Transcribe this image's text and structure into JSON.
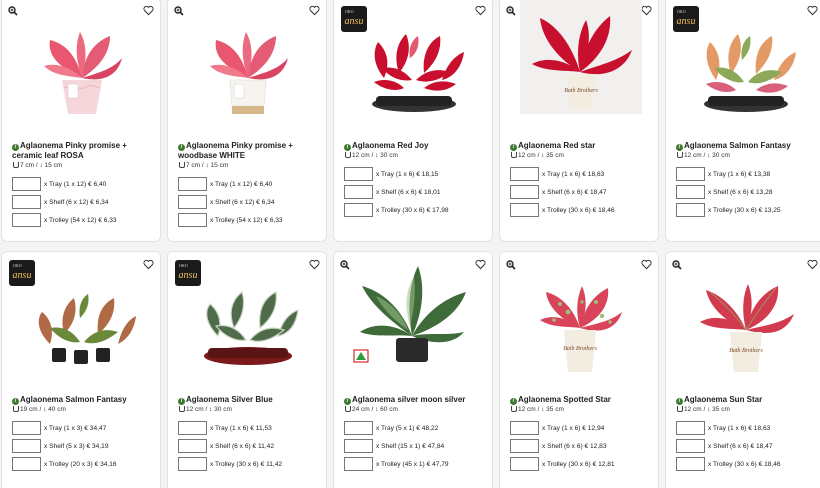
{
  "products": [
    {
      "name": "Aglaonema Pinky promise + ceramic leaf ROSA",
      "dims": "7 cm / ↕ 15 cm",
      "opts": [
        "x Tray (1 x 12) € 6,40",
        "x Shelf (6 x 12) € 6,34",
        "x Trolley (54 x 12) € 6,33"
      ],
      "brand": false,
      "zoom": true,
      "pot": "pink",
      "leaf": "#e8566f"
    },
    {
      "name": "Aglaonema Pinky promise + woodbase WHITE",
      "dims": "7 cm / ↕ 15 cm",
      "opts": [
        "x Tray (1 x 12) € 6,40",
        "x Shelf (6 x 12) € 6,34",
        "x Trolley (54 x 12) € 6,33"
      ],
      "brand": false,
      "zoom": true,
      "pot": "white",
      "leaf": "#e8566f"
    },
    {
      "name": "Aglaonema Red Joy",
      "dims": "12 cm / ↕ 30 cm",
      "opts": [
        "x Tray (1 x 6) € 18,15",
        "x Shelf (6 x 6) € 18,01",
        "x Trolley (30 x 6) € 17,98"
      ],
      "brand": true,
      "zoom": false,
      "pot": "tray",
      "leaf": "#c8102e"
    },
    {
      "name": "Aglaonema Red star",
      "dims": "12 cm / ↕ 35 cm",
      "opts": [
        "x Tray (1 x 6) € 18,63",
        "x Shelf (6 x 6) € 18,47",
        "x Trolley (30 x 6) € 18,46"
      ],
      "brand": false,
      "zoom": true,
      "pot": "sleeve",
      "leaf": "#c8102e"
    },
    {
      "name": "Aglaonema Salmon Fantasy",
      "dims": "12 cm / ↕ 30 cm",
      "opts": [
        "x Tray (1 x 6) € 13,38",
        "x Shelf (6 x 6) € 13,28",
        "x Trolley (30 x 6) € 13,25"
      ],
      "brand": true,
      "zoom": false,
      "pot": "tray",
      "leaf": "#e7a06a"
    },
    {
      "name": "Aglaonema Salmon Fantasy",
      "dims": "19 cm / ↕ 40 cm",
      "opts": [
        "x Tray (1 x 3) € 34,47",
        "x Shelf (5 x 3) € 34,19",
        "x Trolley (20 x 3) € 34,16"
      ],
      "brand": true,
      "zoom": false,
      "pot": "tray3",
      "leaf": "#b8704a"
    },
    {
      "name": "Aglaonema Silver Blue",
      "dims": "12 cm / ↕ 30 cm",
      "opts": [
        "x Tray (1 x 6) € 11,53",
        "x Shelf (6 x 6) € 11,42",
        "x Trolley (30 x 6) € 11,42"
      ],
      "brand": true,
      "zoom": false,
      "pot": "tray",
      "leaf": "#7b9a78"
    },
    {
      "name": "Aglaonema silver moon silver",
      "dims": "24 cm / ↕ 60 cm",
      "opts": [
        "x Tray (5 x 1) € 48,22",
        "x Shelf (15 x 1) € 47,84",
        "x Trolley (45 x 1) € 47,79"
      ],
      "brand": false,
      "zoom": true,
      "pot": "big",
      "leaf": "#3f6b3a"
    },
    {
      "name": "Aglaonema Spotted Star",
      "dims": "12 cm / ↕ 35 cm",
      "opts": [
        "x Tray (1 x 6) € 12,94",
        "x Shelf (6 x 6) € 12,83",
        "x Trolley (30 x 6) € 12,81"
      ],
      "brand": false,
      "zoom": true,
      "pot": "sleeve",
      "leaf": "#d9445a"
    },
    {
      "name": "Aglaonema Sun Star",
      "dims": "12 cm / ↕ 35 cm",
      "opts": [
        "x Tray (1 x 6) € 18,63",
        "x Shelf (6 x 6) € 18,47",
        "x Trolley (30 x 6) € 18,46"
      ],
      "brand": false,
      "zoom": true,
      "pot": "sleeve",
      "leaf": "#d23a4e"
    }
  ],
  "brand_label": "ansu",
  "brand_sublabel": "OKO",
  "pot_sleeve_text": "Bath Brothers"
}
